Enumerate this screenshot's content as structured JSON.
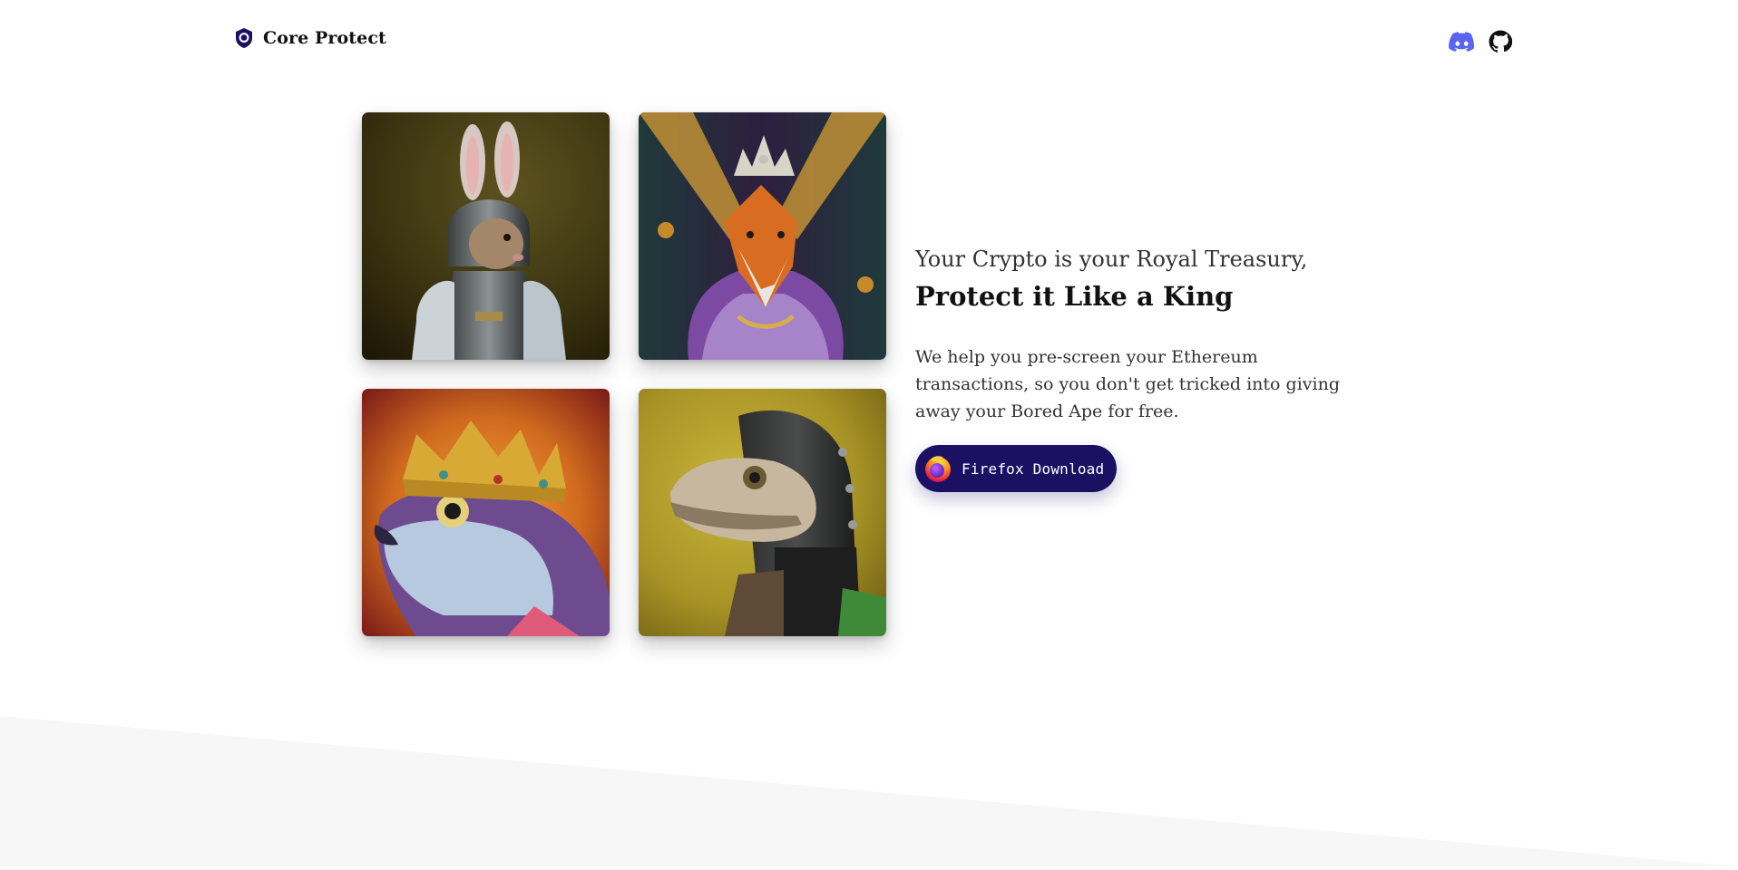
{
  "header": {
    "brand_name": "Core Protect",
    "brand_icon": "shield-icon",
    "social": [
      {
        "name": "discord-icon",
        "color": "#5865F2"
      },
      {
        "name": "github-icon",
        "color": "#111111"
      }
    ]
  },
  "gallery": {
    "images": [
      {
        "subject": "rabbit-in-armor",
        "icon": "rabbit-knight-portrait"
      },
      {
        "subject": "fox-with-crown",
        "icon": "fox-king-portrait"
      },
      {
        "subject": "fish-with-crown",
        "icon": "fish-king-portrait"
      },
      {
        "subject": "lizard-in-helmet",
        "icon": "lizard-knight-portrait"
      }
    ]
  },
  "hero": {
    "tagline": "Your Crypto is your Royal Treasury,",
    "headline": "Protect it Like a King",
    "description": "We help you pre-screen your Ethereum transactions, so you don't get tricked into giving away your Bored Ape for free.",
    "cta_label": "Firefox Download",
    "cta_icon": "firefox-icon"
  },
  "colors": {
    "brand_accent": "#1c1063",
    "discord": "#5865F2",
    "footer_band": "#f7f7f7"
  }
}
